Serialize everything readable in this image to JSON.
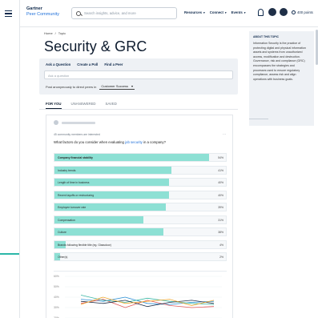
{
  "header": {
    "logo_line1": "Gartner",
    "logo_line2": "Peer Community",
    "search_placeholder": "Search insights, advice, and more",
    "nav": [
      {
        "label": "Resources"
      },
      {
        "label": "Connect"
      },
      {
        "label": "Events"
      }
    ],
    "points": "400 points"
  },
  "breadcrumb": [
    "Home",
    "/",
    "Topic"
  ],
  "page_title": "Security & GRC",
  "ask": {
    "tabs": [
      "Ask a Question",
      "Create a Poll",
      "Find a Peer"
    ],
    "placeholder": "Ask a question",
    "post_label": "Post anonymously to direct peers in",
    "post_select": "Customer Success",
    "chevron": "▾"
  },
  "feed_tabs": [
    "FOR YOU",
    "UNANSWERED",
    "SAVED"
  ],
  "poll": {
    "meta": "45 community members are interested",
    "more": "···",
    "question_pre": "What factors do you consider when evaluating ",
    "question_highlight": "job security",
    "question_post": " in a company?",
    "options": [
      {
        "label": "Company financial stability",
        "percent": 54,
        "pct_text": "54%"
      },
      {
        "label": "Industry trends",
        "percent": 41,
        "pct_text": "41%"
      },
      {
        "label": "Length of time in business",
        "percent": 40,
        "pct_text": "40%"
      },
      {
        "label": "Recent layoffs or restructuring",
        "percent": 40,
        "pct_text": "40%"
      },
      {
        "label": "Employee turnover rate",
        "percent": 39,
        "pct_text": "39%"
      },
      {
        "label": "Compensation",
        "percent": 31,
        "pct_text": "31%"
      },
      {
        "label": "Culture",
        "percent": 38,
        "pct_text": "38%"
      },
      {
        "label": "Brands following flexible title (eg. Glassdoor)",
        "percent": 4,
        "pct_text": "4%"
      },
      {
        "label": "Other(s)",
        "percent": 2,
        "pct_text": "2%"
      }
    ]
  },
  "mini_chart": {
    "type": "line",
    "y_ticks": [
      "60%",
      "50%",
      "40%",
      "30%",
      "20%"
    ],
    "series": [
      {
        "color": "#2a8fd6",
        "values": [
          38,
          36,
          40,
          34,
          33,
          35,
          36
        ]
      },
      {
        "color": "#e05a5a",
        "values": [
          34,
          38,
          30,
          37,
          32,
          30,
          31
        ]
      },
      {
        "color": "#3db8a5",
        "values": [
          42,
          37,
          35,
          39,
          36,
          34,
          33
        ]
      },
      {
        "color": "#1f2f47",
        "values": [
          36,
          34,
          37,
          31,
          35,
          37,
          34
        ]
      },
      {
        "color": "#f0a830",
        "values": [
          33,
          40,
          34,
          36,
          38,
          32,
          37
        ]
      }
    ]
  },
  "topic": {
    "heading": "ABOUT THIS TOPIC",
    "text": "Information Security is the practice of protecting digital and physical information assets and systems from unauthorized access, modification and destruction. Governance, risk and compliance (GRC) encompasses the strategies and processes used to ensure regulatory compliance, assess risk and align operations with business goals."
  },
  "colors": {
    "accent": "#8de0d4",
    "brand_navy": "#102a4c",
    "link": "#1e6fd9"
  }
}
